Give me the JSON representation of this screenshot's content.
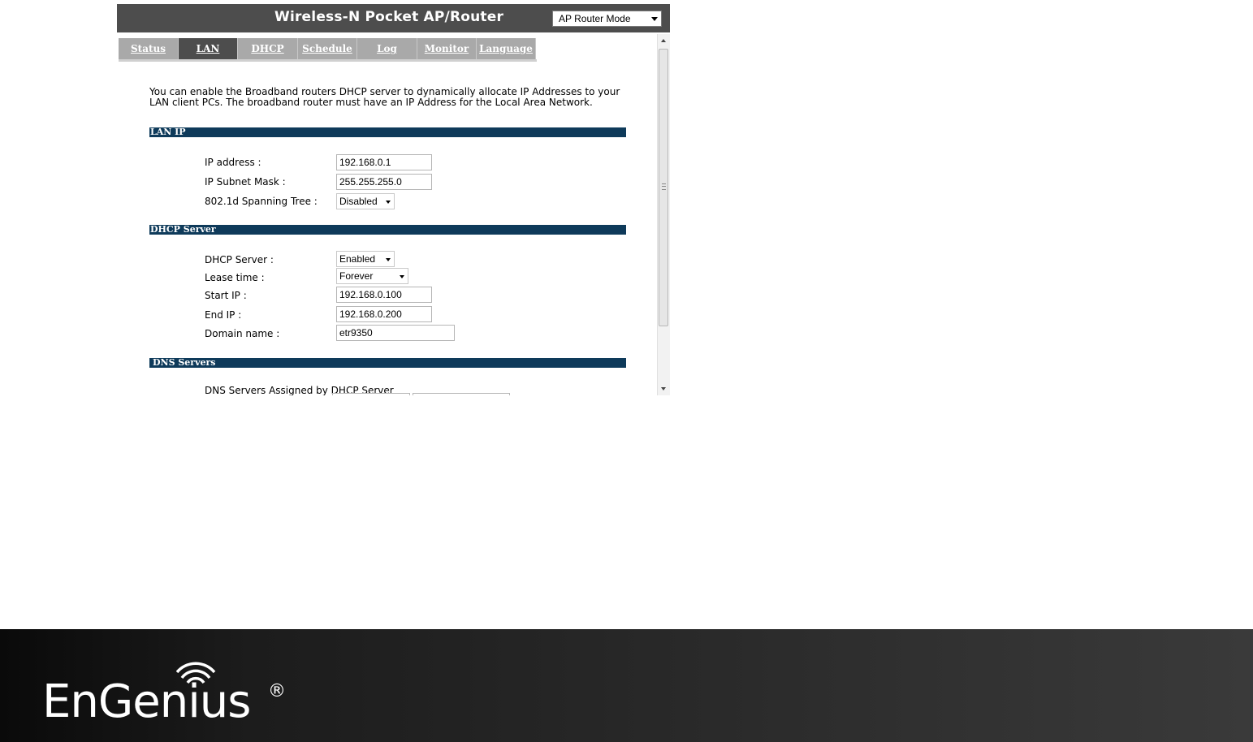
{
  "header": {
    "title": "Wireless-N Pocket AP/Router",
    "mode": "AP Router Mode"
  },
  "tabs": [
    {
      "label": "Status"
    },
    {
      "label": "LAN",
      "active": true
    },
    {
      "label": "DHCP"
    },
    {
      "label": "Schedule"
    },
    {
      "label": "Log"
    },
    {
      "label": "Monitor"
    },
    {
      "label": "Language"
    }
  ],
  "intro": {
    "line1": "You can enable the Broadband routers DHCP server to dynamically allocate IP Addresses to your",
    "line2": "LAN client PCs. The broadband router must have an IP Address for the Local Area Network."
  },
  "lan_ip": {
    "section": "LAN IP",
    "ip_label": "IP address :",
    "ip_value": "192.168.0.1",
    "mask_label": "IP Subnet Mask :",
    "mask_value": "255.255.255.0",
    "stp_label": "802.1d Spanning Tree :",
    "stp_value": "Disabled"
  },
  "dhcp_server": {
    "section": "DHCP Server",
    "server_label": "DHCP Server :",
    "server_value": "Enabled",
    "lease_label": "Lease time :",
    "lease_value": "Forever",
    "start_label": "Start IP :",
    "start_value": "192.168.0.100",
    "end_label": "End IP :",
    "end_value": "192.168.0.200",
    "domain_label": "Domain name :",
    "domain_value": "etr9350"
  },
  "dns_servers": {
    "section": "DNS Servers",
    "assigned_label": "DNS Servers Assigned by DHCP Server"
  },
  "footer": {
    "brand": "EnGenius",
    "registered": "®"
  },
  "colors": {
    "header_bg": "#4d4d4d",
    "section_bar": "#0e3a5a",
    "tab_inactive": "#a9a9a9"
  }
}
